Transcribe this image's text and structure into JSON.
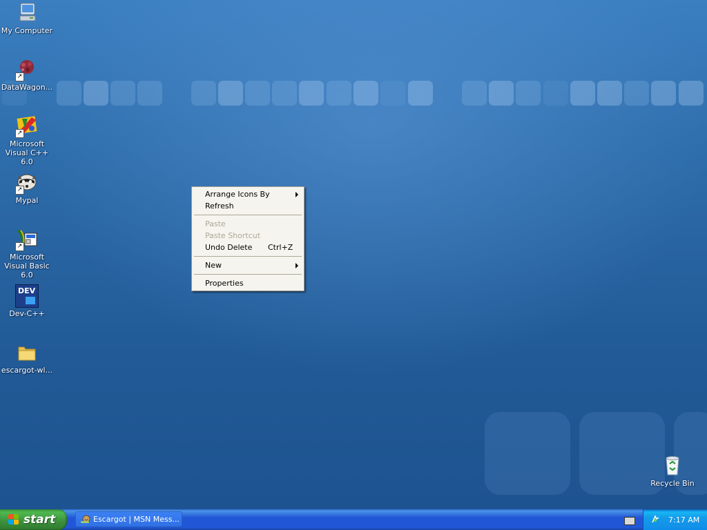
{
  "desktop": {
    "icons": [
      {
        "label": "My Computer",
        "icon": "my-computer-icon"
      },
      {
        "label": "DataWagon...",
        "icon": "datawagon-icon"
      },
      {
        "label": "Microsoft Visual C++ 6.0",
        "icon": "visual-cpp-icon"
      },
      {
        "label": "Mypal",
        "icon": "mypal-icon"
      },
      {
        "label": "Microsoft Visual Basic 6.0",
        "icon": "visual-basic-icon"
      },
      {
        "label": "Dev-C++",
        "icon": "dev-cpp-icon"
      },
      {
        "label": "escargot-wl...",
        "icon": "folder-icon"
      }
    ],
    "recycle_bin": {
      "label": "Recycle Bin",
      "icon": "recycle-bin-icon"
    },
    "dev_icon_text": "DEV"
  },
  "context_menu": {
    "items": [
      {
        "label": "Arrange Icons By",
        "submenu": true
      },
      {
        "label": "Refresh"
      },
      {
        "label": "Paste",
        "disabled": true
      },
      {
        "label": "Paste Shortcut",
        "disabled": true
      },
      {
        "label": "Undo Delete",
        "shortcut": "Ctrl+Z"
      },
      {
        "label": "New",
        "submenu": true
      },
      {
        "label": "Properties"
      }
    ]
  },
  "taskbar": {
    "start_label": "start",
    "tasks": [
      {
        "label": "Escargot | MSN Mess...",
        "icon": "escargot-icon"
      }
    ],
    "clock": "7:17 AM"
  },
  "colors": {
    "accent": "#2157d7",
    "start": "#3c8f3c",
    "tray": "#139beb"
  }
}
